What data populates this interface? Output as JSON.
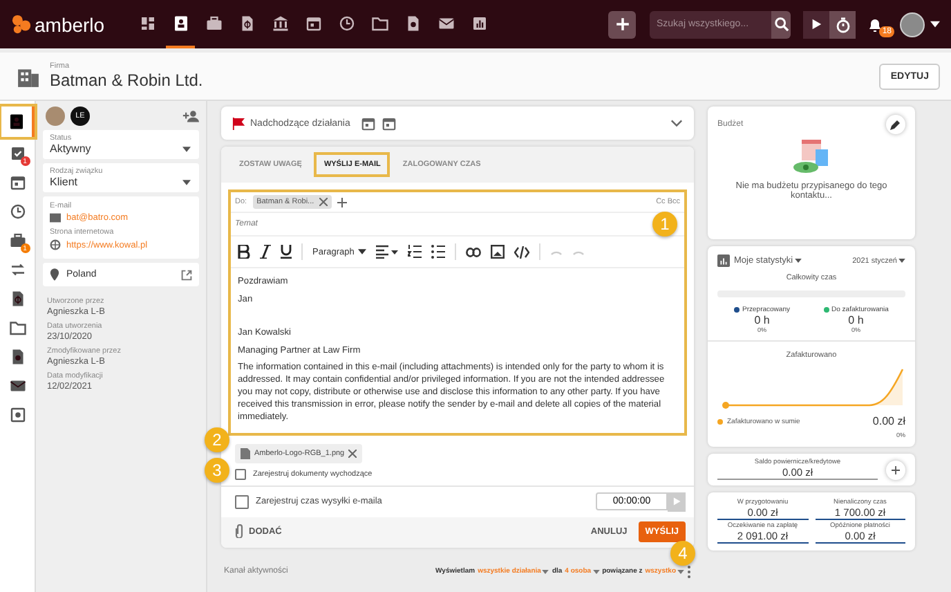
{
  "topbar": {
    "logo": "amberlo",
    "nav": [
      {
        "selected": false
      },
      {
        "selected": true
      },
      {
        "selected": false
      },
      {
        "selected": false
      },
      {
        "selected": false
      },
      {
        "selected": false
      },
      {
        "selected": false
      },
      {
        "selected": false
      },
      {
        "selected": false
      },
      {
        "selected": false
      },
      {
        "selected": false
      }
    ],
    "search": {
      "placeholder": "Szukaj wszystkiego..."
    },
    "notifications": "18"
  },
  "header": {
    "label": "Firma",
    "title": "Batman & Robin Ltd.",
    "button": "EDYTUJ"
  },
  "rail": [
    {
      "selected": true,
      "highlighted": true
    },
    {
      "selected": false,
      "highlighted": false,
      "badge": "1",
      "color": "#e53935"
    },
    {
      "selected": false,
      "highlighted": false
    },
    {
      "selected": false,
      "highlighted": false
    },
    {
      "selected": false,
      "highlighted": false,
      "badge": "1",
      "color": "#f57c00"
    },
    {
      "selected": false,
      "highlighted": false
    },
    {
      "selected": false,
      "highlighted": false
    },
    {
      "selected": false,
      "highlighted": false
    },
    {
      "selected": false,
      "highlighted": false
    },
    {
      "selected": false,
      "highlighted": false
    },
    {
      "selected": false,
      "highlighted": false
    }
  ],
  "contact": {
    "avatar_initials": "LE",
    "selects": [
      {
        "label": "Status",
        "value": "Aktywny"
      },
      {
        "label": "Rodzaj związku",
        "value": "Klient"
      }
    ],
    "email": {
      "label": "E-mail",
      "value": "bat@batro.com"
    },
    "website": {
      "label": "Strona internetowa",
      "value": "https://www.kowal.pl"
    },
    "location": "Poland",
    "meta": [
      {
        "label": "Utworzone przez",
        "value": "Agnieszka L-B"
      },
      {
        "label": "Data utworzenia",
        "value": "23/10/2020"
      },
      {
        "label": "Zmodyfikowane przez",
        "value": "Agnieszka L-B"
      },
      {
        "label": "Data modyfikacji",
        "value": "12/02/2021"
      }
    ]
  },
  "upcoming": {
    "title": "Nadchodzące działania",
    "expanded": false
  },
  "tabs": [
    {
      "label": "ZOSTAW UWAGĘ",
      "selected": false,
      "highlighted": false
    },
    {
      "label": "WYŚLIJ E-MAIL",
      "selected": true,
      "highlighted": true
    },
    {
      "label": "ZALOGOWANY CZAS",
      "selected": false,
      "highlighted": false
    }
  ],
  "composer": {
    "highlighted": true,
    "to_label": "Do:",
    "recipient": "Batman & Robi...",
    "cc_bcc": "Cc Bcc",
    "subject_placeholder": "Temat",
    "block_format": "Paragraph",
    "closing": [
      "Pozdrawiam",
      "Jan"
    ],
    "signature": [
      "Jan Kowalski",
      "Managing Partner at Law Firm",
      "The information contained in this e-mail (including attachments) is intended only for the party to whom it is addressed. It may contain confidential and/or privileged information. If you are not the intended addressee you may not copy, distribute or otherwise use and disclose this information to any other party. If you have received this transmission in error, please notify the sender by e-mail and delete all copies of the material immediately."
    ],
    "attachment": "Amberlo-Logo-RGB_1.png",
    "register_docs": {
      "label": "Zarejestruj dokumenty wychodzące",
      "checked": false
    },
    "register_time": {
      "label": "Zarejestruj czas wysyłki e-maila",
      "checked": false
    },
    "time": "00:00:00",
    "add": "DODAĆ",
    "cancel": "ANULUJ",
    "send": "WYŚLIJ"
  },
  "callouts": [
    "1",
    "2",
    "3",
    "4"
  ],
  "activity": {
    "title": "Kanał aktywności",
    "filter": [
      {
        "text": "Wyświetlam",
        "kind": "text"
      },
      {
        "text": "wszystkie działania",
        "kind": "link"
      },
      {
        "text": "dla",
        "kind": "text"
      },
      {
        "text": "4 osoba",
        "kind": "link"
      },
      {
        "text": "powiązane z",
        "kind": "text"
      },
      {
        "text": "wszystko",
        "kind": "link"
      }
    ]
  },
  "budget": {
    "title": "Budżet",
    "empty": "Nie ma budżetu przypisanego do tego kontaktu..."
  },
  "stats": {
    "title": "Moje statystyki",
    "period": "2021 styczeń",
    "total_label": "Całkowity czas",
    "level": 0,
    "legend": [
      {
        "name": "Przepracowany",
        "color": "#1f4e8c",
        "value": "0 h",
        "pct": "0%"
      },
      {
        "name": "Do zafakturowania",
        "color": "#2eb872",
        "value": "0 h",
        "pct": "0%"
      }
    ],
    "invoiced_label": "Zafakturowano",
    "invoiced_legend": {
      "name": "Zafakturowano w sumie",
      "color": "#f5a623",
      "value": "0.00 zł",
      "pct": "0%"
    }
  },
  "balance": {
    "label": "Saldo powiernicze/kredytowe",
    "value": "0.00 zł"
  },
  "finance": [
    {
      "label": "W przygotowaniu",
      "value": "0.00 zł"
    },
    {
      "label": "Nienaliczony czas",
      "value": "1 700.00 zł"
    },
    {
      "label": "Oczekiwanie na zapłatę",
      "value": "2 091.00 zł"
    },
    {
      "label": "Opóźnione płatności",
      "value": "0.00 zł"
    }
  ]
}
